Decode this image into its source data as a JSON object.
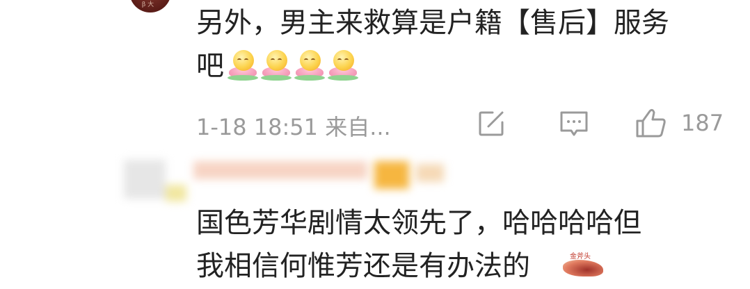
{
  "comment1": {
    "line1": "另外，男主来救算是户籍【售后】服务",
    "line2": "吧",
    "emojis": [
      "lotus-emoji",
      "lotus-emoji",
      "lotus-emoji",
      "lotus-emoji"
    ],
    "timestamp": "1-18 18:51  来自...",
    "like_count": "187",
    "avatar_text": "β 大"
  },
  "comment2": {
    "line1": "国色芳华剧情太领先了，哈哈哈哈但",
    "line2": "我相信何惟芳还是有办法的",
    "sticker_text": "金斧头"
  },
  "colors": {
    "text": "#222222",
    "meta": "#9a9a9a"
  }
}
